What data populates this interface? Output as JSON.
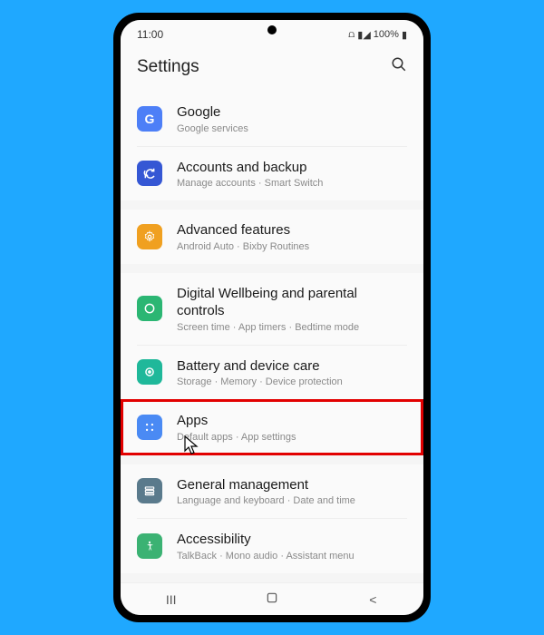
{
  "status": {
    "time": "11:00",
    "battery": "100%"
  },
  "header": {
    "title": "Settings"
  },
  "colors": {
    "google": "#4d7ff7",
    "accounts": "#3557d4",
    "advanced": "#f0a020",
    "wellbeing": "#2bb673",
    "battery": "#1fb89a",
    "apps": "#4a8af4",
    "general": "#5a7a8c",
    "accessibility": "#3bb273"
  },
  "items": {
    "google": {
      "title": "Google",
      "sub": "Google services"
    },
    "accounts": {
      "title": "Accounts and backup",
      "sub": "Manage accounts · Smart Switch"
    },
    "advanced": {
      "title": "Advanced features",
      "sub": "Android Auto · Bixby Routines"
    },
    "wellbeing": {
      "title": "Digital Wellbeing and parental controls",
      "sub": "Screen time · App timers · Bedtime mode"
    },
    "battery": {
      "title": "Battery and device care",
      "sub": "Storage · Memory · Device protection"
    },
    "apps": {
      "title": "Apps",
      "sub": "Default apps · App settings"
    },
    "general": {
      "title": "General management",
      "sub": "Language and keyboard · Date and time"
    },
    "accessibility": {
      "title": "Accessibility",
      "sub": "TalkBack · Mono audio · Assistant menu"
    }
  }
}
